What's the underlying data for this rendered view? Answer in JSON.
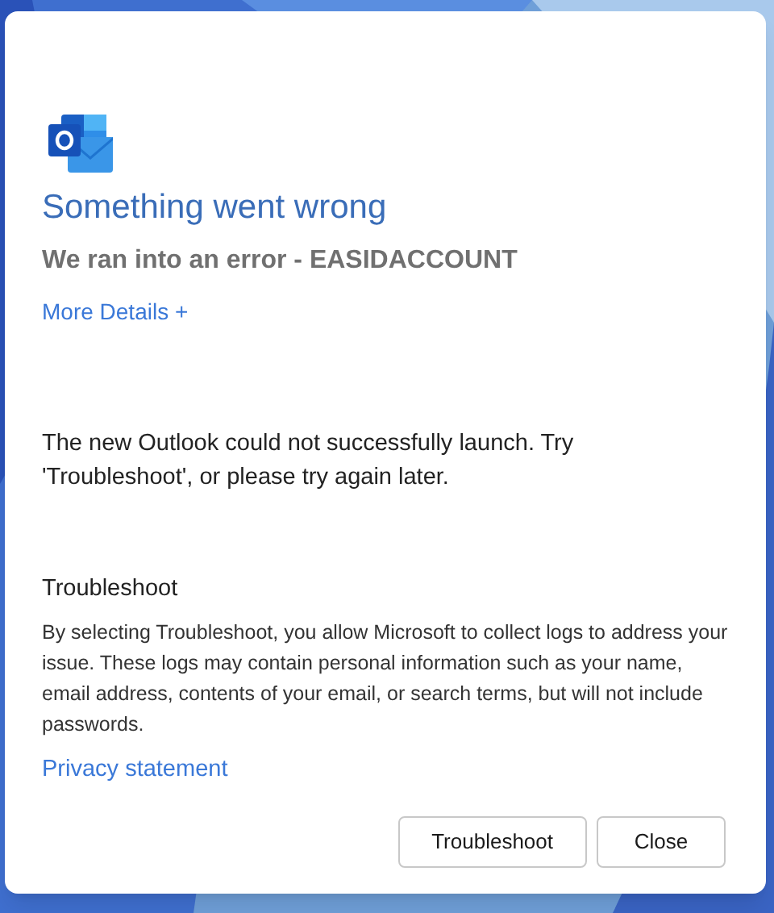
{
  "dialog": {
    "title": "Something went wrong",
    "subtitle": "We ran into an error - EASIDACCOUNT",
    "details_link": "More Details +",
    "message": "The new Outlook could not successfully launch. Try 'Troubleshoot', or please try again later.",
    "section_title": "Troubleshoot",
    "section_text": "By selecting Troubleshoot, you allow Microsoft to collect logs to address your issue. These logs may contain personal information such as your name, email address, contents of your email, or search terms, but will not include passwords.",
    "privacy_link": "Privacy statement",
    "buttons": [
      {
        "label": "Troubleshoot"
      },
      {
        "label": "Close"
      }
    ]
  }
}
